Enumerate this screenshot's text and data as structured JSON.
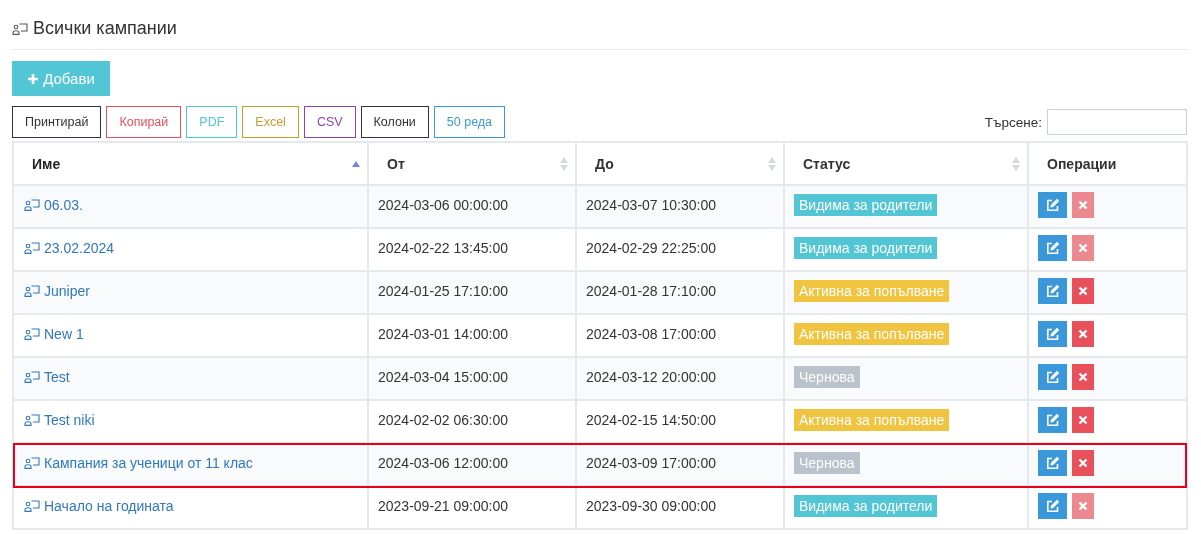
{
  "title": "Всички кампании",
  "add_button": "Добави",
  "export_buttons": [
    {
      "label": "Принтирай",
      "color": "#333333"
    },
    {
      "label": "Копирай",
      "color": "#e8505b"
    },
    {
      "label": "PDF",
      "color": "#4fc7d6"
    },
    {
      "label": "Excel",
      "color": "#c99a2e"
    },
    {
      "label": "CSV",
      "color": "#8e44ad"
    },
    {
      "label": "Колони",
      "color": "#333333"
    },
    {
      "label": "50 реда",
      "color": "#3b98da"
    }
  ],
  "search": {
    "label": "Търсене:"
  },
  "table": {
    "columns": [
      {
        "label": "Име",
        "sortable": true,
        "sorted": true
      },
      {
        "label": "От",
        "sortable": true,
        "sorted": false
      },
      {
        "label": "До",
        "sortable": true,
        "sorted": false
      },
      {
        "label": "Статус",
        "sortable": true,
        "sorted": false
      },
      {
        "label": "Операции",
        "sortable": false,
        "sorted": false
      }
    ],
    "rows": [
      {
        "name": "06.03.",
        "from": "2024-03-06 00:00:00",
        "to": "2024-03-07 10:30:00",
        "status": "Видима за родители",
        "kind": "visible",
        "delete_disabled": true,
        "highlighted": false
      },
      {
        "name": "23.02.2024",
        "from": "2024-02-22 13:45:00",
        "to": "2024-02-29 22:25:00",
        "status": "Видима за родители",
        "kind": "visible",
        "delete_disabled": true,
        "highlighted": false
      },
      {
        "name": "Juniper",
        "from": "2024-01-25 17:10:00",
        "to": "2024-01-28 17:10:00",
        "status": "Активна за попълване",
        "kind": "active",
        "delete_disabled": false,
        "highlighted": false
      },
      {
        "name": "New 1",
        "from": "2024-03-01 14:00:00",
        "to": "2024-03-08 17:00:00",
        "status": "Активна за попълване",
        "kind": "active",
        "delete_disabled": false,
        "highlighted": false
      },
      {
        "name": "Test",
        "from": "2024-03-04 15:00:00",
        "to": "2024-03-12 20:00:00",
        "status": "Чернова",
        "kind": "draft",
        "delete_disabled": false,
        "highlighted": false
      },
      {
        "name": "Test niki",
        "from": "2024-02-02 06:30:00",
        "to": "2024-02-15 14:50:00",
        "status": "Активна за попълване",
        "kind": "active",
        "delete_disabled": false,
        "highlighted": false
      },
      {
        "name": "Кампания за ученици от 11 клас",
        "from": "2024-03-06 12:00:00",
        "to": "2024-03-09 17:00:00",
        "status": "Чернова",
        "kind": "draft",
        "delete_disabled": false,
        "highlighted": true
      },
      {
        "name": "Начало на годината",
        "from": "2023-09-21 09:00:00",
        "to": "2023-09-30 09:00:00",
        "status": "Видима за родители",
        "kind": "visible",
        "delete_disabled": true,
        "highlighted": false
      }
    ]
  }
}
